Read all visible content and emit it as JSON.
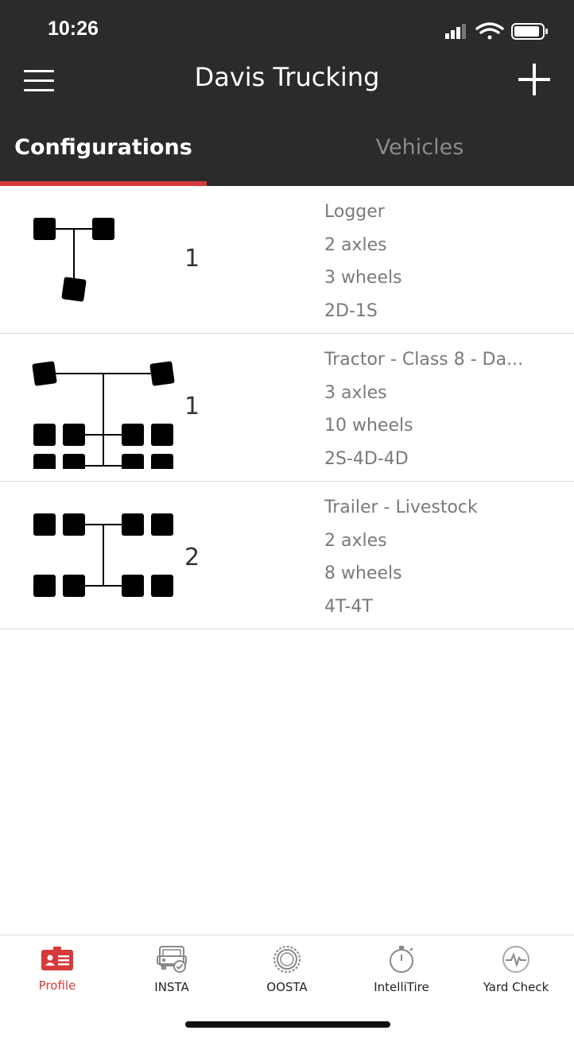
{
  "status": {
    "time": "10:26"
  },
  "header": {
    "title": "Davis Trucking",
    "menu_icon": "hamburger-menu-icon",
    "add_icon": "plus-icon"
  },
  "tabs": [
    {
      "label": "Configurations",
      "active": true
    },
    {
      "label": "Vehicles",
      "active": false
    }
  ],
  "configurations": [
    {
      "name": "Logger",
      "axles": "2 axles",
      "wheels": "3 wheels",
      "code": "2D-1S",
      "count": "1"
    },
    {
      "name": "Tractor - Class 8 - Da...",
      "axles": "3 axles",
      "wheels": "10 wheels",
      "code": "2S-4D-4D",
      "count": "1"
    },
    {
      "name": "Trailer - Livestock",
      "axles": "2 axles",
      "wheels": "8 wheels",
      "code": "4T-4T",
      "count": "2"
    }
  ],
  "tabbar": [
    {
      "label": "Profile",
      "icon": "profile-card-icon",
      "active": true
    },
    {
      "label": "INSTA",
      "icon": "truck-check-icon",
      "active": false
    },
    {
      "label": "OOSTA",
      "icon": "tire-icon",
      "active": false
    },
    {
      "label": "IntelliTire",
      "icon": "stopwatch-icon",
      "active": false
    },
    {
      "label": "Yard Check",
      "icon": "heartbeat-icon",
      "active": false
    }
  ],
  "colors": {
    "header": "#2b2b2b",
    "accent": "#d63a3a",
    "muted": "#7a7a7a"
  }
}
